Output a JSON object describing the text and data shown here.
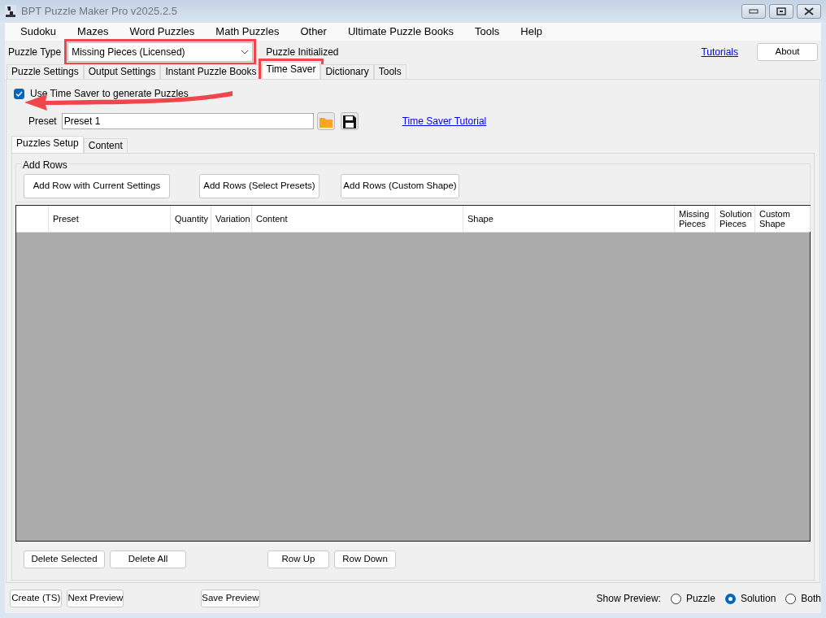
{
  "window": {
    "title": "BPT Puzzle Maker Pro v2025.2.5"
  },
  "menu": [
    "Sudoku",
    "Mazes",
    "Word Puzzles",
    "Math Puzzles",
    "Other",
    "Ultimate Puzzle Books",
    "Tools",
    "Help"
  ],
  "puzzle_type": {
    "label": "Puzzle Type",
    "value": "Missing Pieces (Licensed)",
    "highlighted": true,
    "status": "Puzzle Initialized"
  },
  "top_links": {
    "tutorials": "Tutorials",
    "about": "About"
  },
  "tabs": [
    {
      "label": "Puzzle Settings",
      "selected": false,
      "highlighted": false
    },
    {
      "label": "Output Settings",
      "selected": false,
      "highlighted": false
    },
    {
      "label": "Instant Puzzle Books",
      "selected": false,
      "highlighted": false
    },
    {
      "label": "Time Saver",
      "selected": true,
      "highlighted": true
    },
    {
      "label": "Dictionary",
      "selected": false,
      "highlighted": false
    },
    {
      "label": "Tools",
      "selected": false,
      "highlighted": false
    }
  ],
  "use_time_saver": {
    "label": "Use Time Saver to generate Puzzles",
    "checked": true
  },
  "callout_arrow": true,
  "preset": {
    "label": "Preset",
    "value": "Preset 1",
    "link": "Time Saver Tutorial"
  },
  "inner_tabs": [
    {
      "label": "Puzzles Setup",
      "selected": true
    },
    {
      "label": "Content",
      "selected": false
    }
  ],
  "add_rows": {
    "title": "Add Rows",
    "buttons": [
      "Add Row with Current Settings",
      "Add Rows (Select Presets)",
      "Add Rows (Custom Shape)"
    ]
  },
  "table": {
    "columns": [
      "Preset",
      "Quantity",
      "Variation",
      "Content",
      "Shape",
      "Missing Pieces",
      "Solution Pieces",
      "Custom Shape"
    ]
  },
  "row_buttons": [
    "Delete Selected",
    "Delete All",
    "Row Up",
    "Row Down"
  ],
  "footer_buttons": [
    "Create (TS)",
    "Next Preview",
    "Save Preview"
  ],
  "show_preview": {
    "label": "Show Preview:",
    "options": [
      {
        "label": "Puzzle",
        "selected": false
      },
      {
        "label": "Solution",
        "selected": true
      },
      {
        "label": "Both",
        "selected": false
      }
    ]
  }
}
